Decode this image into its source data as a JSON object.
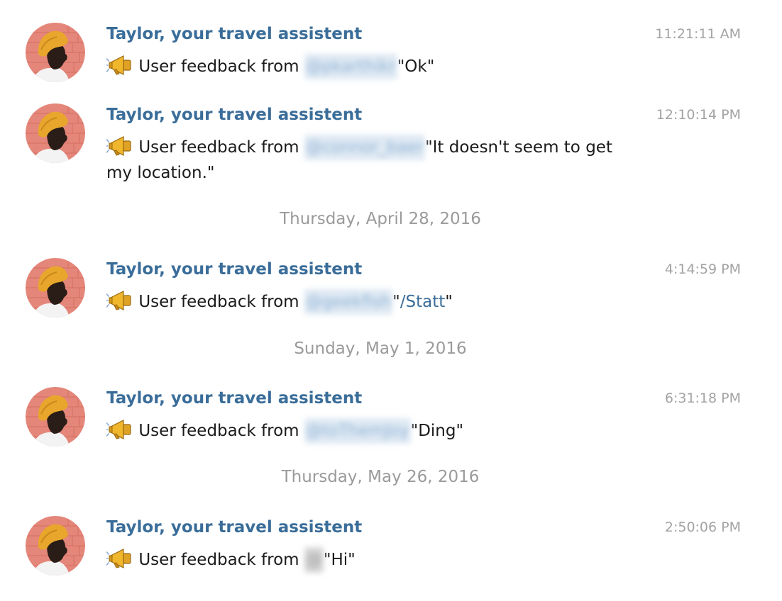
{
  "messages": [
    {
      "sender": "Taylor, your travel assistent",
      "time": "11:21:11 AM",
      "prefix": "User feedback from",
      "handle": "@pkarthikr",
      "quote": "\"Ok\"",
      "icon": "megaphone-icon"
    },
    {
      "sender": "Taylor, your travel assistent",
      "time": "12:10:14 PM",
      "prefix": "User feedback from",
      "handle": "@connor_baer",
      "quote": "\"It doesn't seem to get my location.\"",
      "icon": "megaphone-icon"
    },
    {
      "sender": "Taylor, your travel assistent",
      "time": "4:14:59 PM",
      "prefix": "User feedback from",
      "handle": "@geekfish",
      "quote_open": "\"",
      "command": "/Statt",
      "quote_close": "\"",
      "icon": "megaphone-icon"
    },
    {
      "sender": "Taylor, your travel assistent",
      "time": "6:31:18 PM",
      "prefix": "User feedback from",
      "handle": "@toThemJoy",
      "quote": "\"Ding\"",
      "icon": "megaphone-icon"
    },
    {
      "sender": "Taylor, your travel assistent",
      "time": "2:50:06 PM",
      "prefix": "User feedback from",
      "handle": "@",
      "quote": "\"Hi\"",
      "icon": "megaphone-icon"
    }
  ],
  "date_separators": [
    "Thursday, April 28, 2016",
    "Sunday, May 1, 2016",
    "Thursday, May 26, 2016"
  ],
  "colors": {
    "sender": "#3a6d99",
    "time": "#a3a3a3",
    "date_separator": "#9a9a9a",
    "link": "#3a6d99",
    "avatar_background": "#e4877a",
    "avatar_hat": "#e8a62c"
  }
}
